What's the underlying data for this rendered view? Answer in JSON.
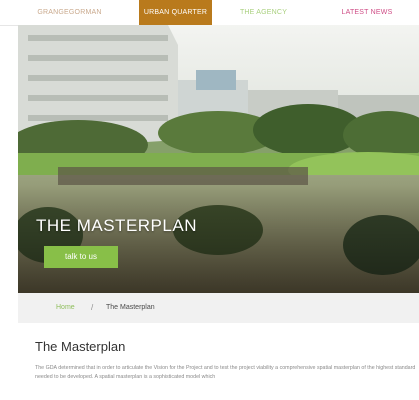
{
  "nav": {
    "items": [
      {
        "label": "GRANGEGORMAN"
      },
      {
        "label": "URBAN QUARTER"
      },
      {
        "label": "THE AGENCY"
      },
      {
        "label": "LATEST NEWS"
      }
    ],
    "active_index": 1
  },
  "hero": {
    "title": "THE MASTERPLAN",
    "button_label": "talk to us"
  },
  "breadcrumb": {
    "home": "Home",
    "separator": "/",
    "current": "The Masterplan"
  },
  "content": {
    "heading": "The Masterplan",
    "body": "The GDA determined that in order to articulate the Vision for the Project and to test the project viability a comprehensive spatial masterplan of the highest standard needed to be developed. A spatial masterplan is a sophisticated model which"
  },
  "colors": {
    "nav_active_bg": "#b97a1c",
    "nav_1": "#c9a98d",
    "nav_3": "#a9d07e",
    "nav_4": "#cf4d86",
    "accent_green": "#88bf48"
  }
}
